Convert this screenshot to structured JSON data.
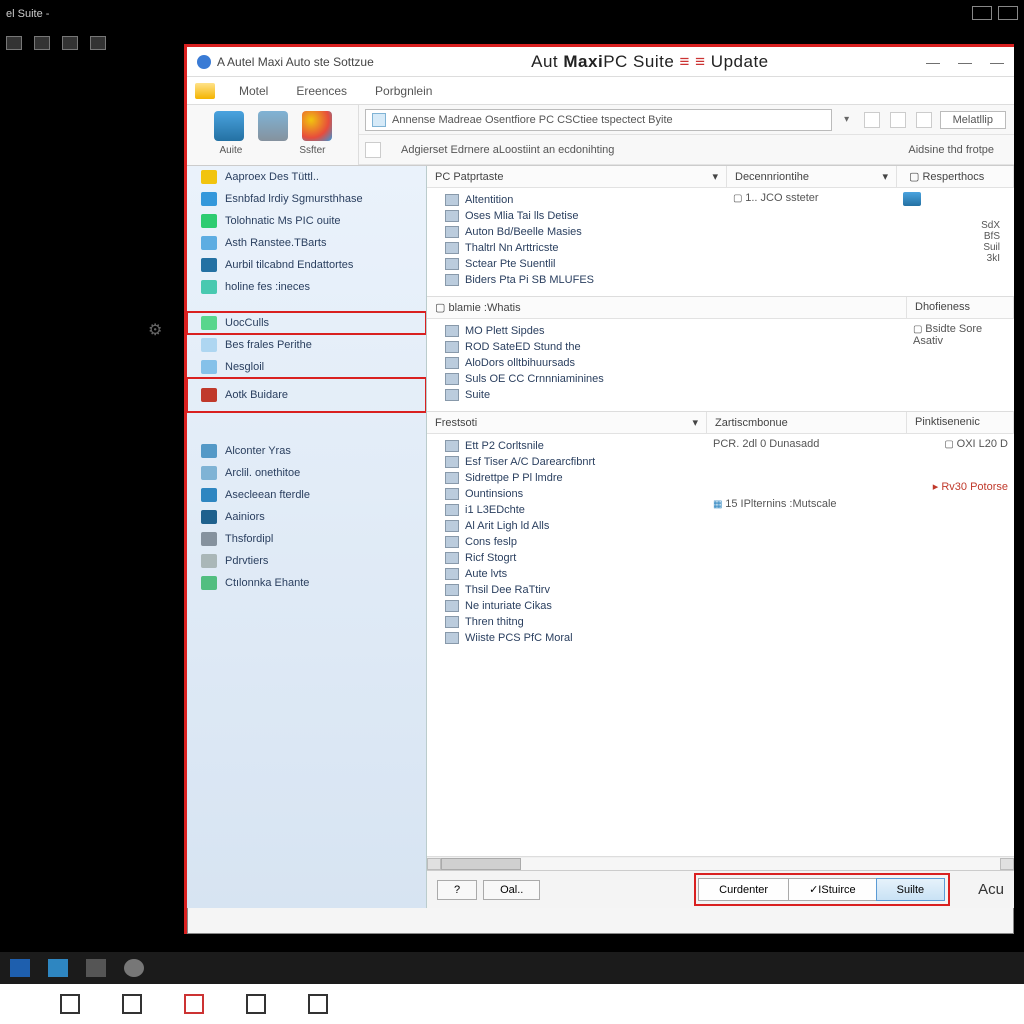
{
  "desktop": {
    "top_title": "el Suite  -",
    "float_gear": "⚙"
  },
  "window": {
    "caption_left": "A Autel Maxi Auto ste Sottzue",
    "title_a": "Aut ",
    "title_b": "Maxi",
    "title_c": "PC  Suite",
    "title_red": " ≡ ≡ ",
    "title_d": "Update",
    "sys": {
      "min": "—",
      "mid": "—",
      "max": "—"
    }
  },
  "menu": {
    "m1": "Motel",
    "m2": "Ereences",
    "m3": "Porbgnlein"
  },
  "ribbon": {
    "cap1": "Auite",
    "cap2": "Ssfter",
    "addr1": "Annense Madreae Osentfiore  PC CSCtiee tspectect Byite",
    "addr2": "Adgierset Edrnere aLoostiint an ecdonihting",
    "btn_right": "Melatllip",
    "btn_right2": "Aidsine thd frotpe"
  },
  "sidebar": {
    "items": [
      {
        "label": "Aaproex Des  Tüttl..",
        "c": "#f1c40f"
      },
      {
        "label": "Esnbfad lrdiy Sgmursthhase",
        "c": "#3498db"
      },
      {
        "label": "Tolohnatic Ms PIC ouite",
        "c": "#2ecc71"
      },
      {
        "label": "Asth Ranstee.TBarts",
        "c": "#5dade2"
      },
      {
        "label": "Aurbil tilcabnd  Endattortes",
        "c": "#2471a3"
      },
      {
        "label": "holine fes :ineces",
        "c": "#48c9b0"
      },
      {
        "label": "UocCulls",
        "c": "#58d68d"
      },
      {
        "label": "Bes frales Perithe",
        "c": "#aed6f1"
      },
      {
        "label": "Nesgloil",
        "c": "#85c1e9"
      },
      {
        "label": "Aotk Buidare",
        "c": "#c0392b"
      },
      {
        "label": "Alconter Yras",
        "c": "#5499c7"
      },
      {
        "label": "Arclil. onethitoe",
        "c": "#7fb3d5"
      },
      {
        "label": "Asecleean fterdle",
        "c": "#2e86c1"
      },
      {
        "label": "Aainiors",
        "c": "#1f618d"
      },
      {
        "label": "Thsfordipl",
        "c": "#85929e"
      },
      {
        "label": "Pdrvtiers",
        "c": "#aab7b8"
      },
      {
        "label": "Ctılonnka Ehante",
        "c": "#52be80"
      }
    ]
  },
  "content": {
    "p1": {
      "h1": "PC Patprtaste",
      "h2": "Decennriontihe",
      "h3": "Resperthocs",
      "side1": "1.. JCO ssteter",
      "list": [
        "Altentition",
        "Oses Mlia Tai lls Detise",
        "Auton Bd/Beelle Masies",
        "Thaltrl Nn Arttricste",
        "Sctear Pte Suentlil",
        "Biders Pta Pi SB MLUFES"
      ],
      "extra": [
        "SdX",
        "BfS",
        "Suil",
        "3kI"
      ]
    },
    "p2": {
      "h1": "blamie :Whatis",
      "h2": "Dhofieness",
      "side1": "Bsidte Sore Asativ",
      "list": [
        "MO Plett Sipdes",
        "ROD SateED Stund the",
        "AloDors olltbihuursads",
        "Suls OE CC Crnnniaminines",
        "Suite"
      ]
    },
    "p3": {
      "h1": "Frestsoti",
      "h2": "Zartiscmbonue",
      "h3": "Pinktisenenic",
      "side1": "PCR.  2dl 0 Dunasadd",
      "extra1": "OXI   L20  D",
      "extra2": "Rv30 Potorse",
      "mid1": "15 IPlternins :Mutscale",
      "list": [
        "Ett P2 Corltsnile",
        "Esf Tiser A/C Darearcfibnrt",
        "Sidrettpe  P Pl lmdre",
        "Ountinsions",
        "i1 L3EDchte",
        "Al Arit Ligh ld Alls",
        "Cons feslp",
        "Ricf Stogrt",
        "Aute lvts",
        "Thsil Dee RaTtirv",
        "Ne inturiate Cikas",
        "Thren thitng",
        "Wiiste PCS PfC Moral"
      ]
    }
  },
  "btnbar": {
    "help": "?",
    "oal": "Oal..",
    "b1": "Curdenter",
    "b2": "✓IStuirce",
    "b3": "Suilte",
    "brand": "Acu"
  }
}
